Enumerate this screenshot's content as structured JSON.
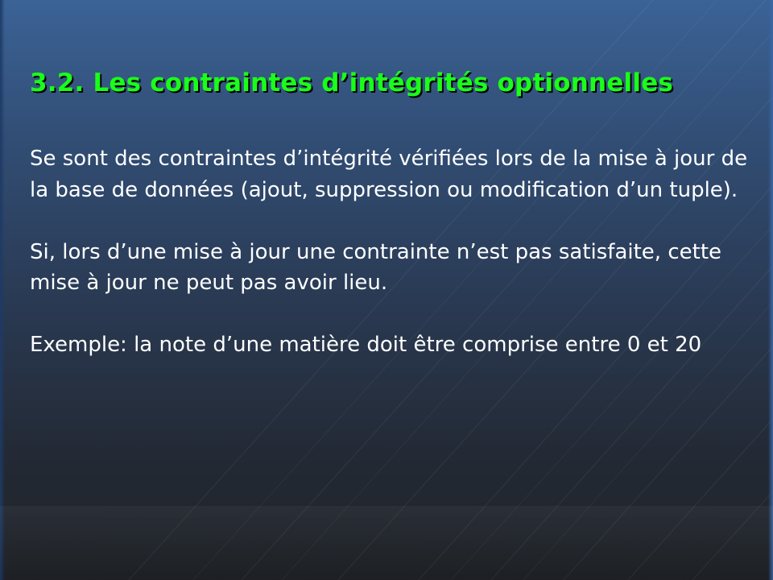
{
  "slide": {
    "title": "3.2. Les contraintes d’intégrités optionnelles",
    "paragraphs": [
      "Se sont des contraintes d’intégrité vérifiées lors de la mise à jour de la base de données (ajout, suppression ou modification d’un tuple).",
      "Si, lors d’une mise à jour une contrainte n’est pas satisfaite, cette mise à jour ne peut pas avoir lieu.",
      "Exemple: la note d’une matière doit être comprise entre 0 et 20"
    ]
  },
  "colors": {
    "title": "#1aff1a",
    "text": "#ffffff",
    "background_top": "#3b6396",
    "background_bottom": "#1f2227"
  }
}
